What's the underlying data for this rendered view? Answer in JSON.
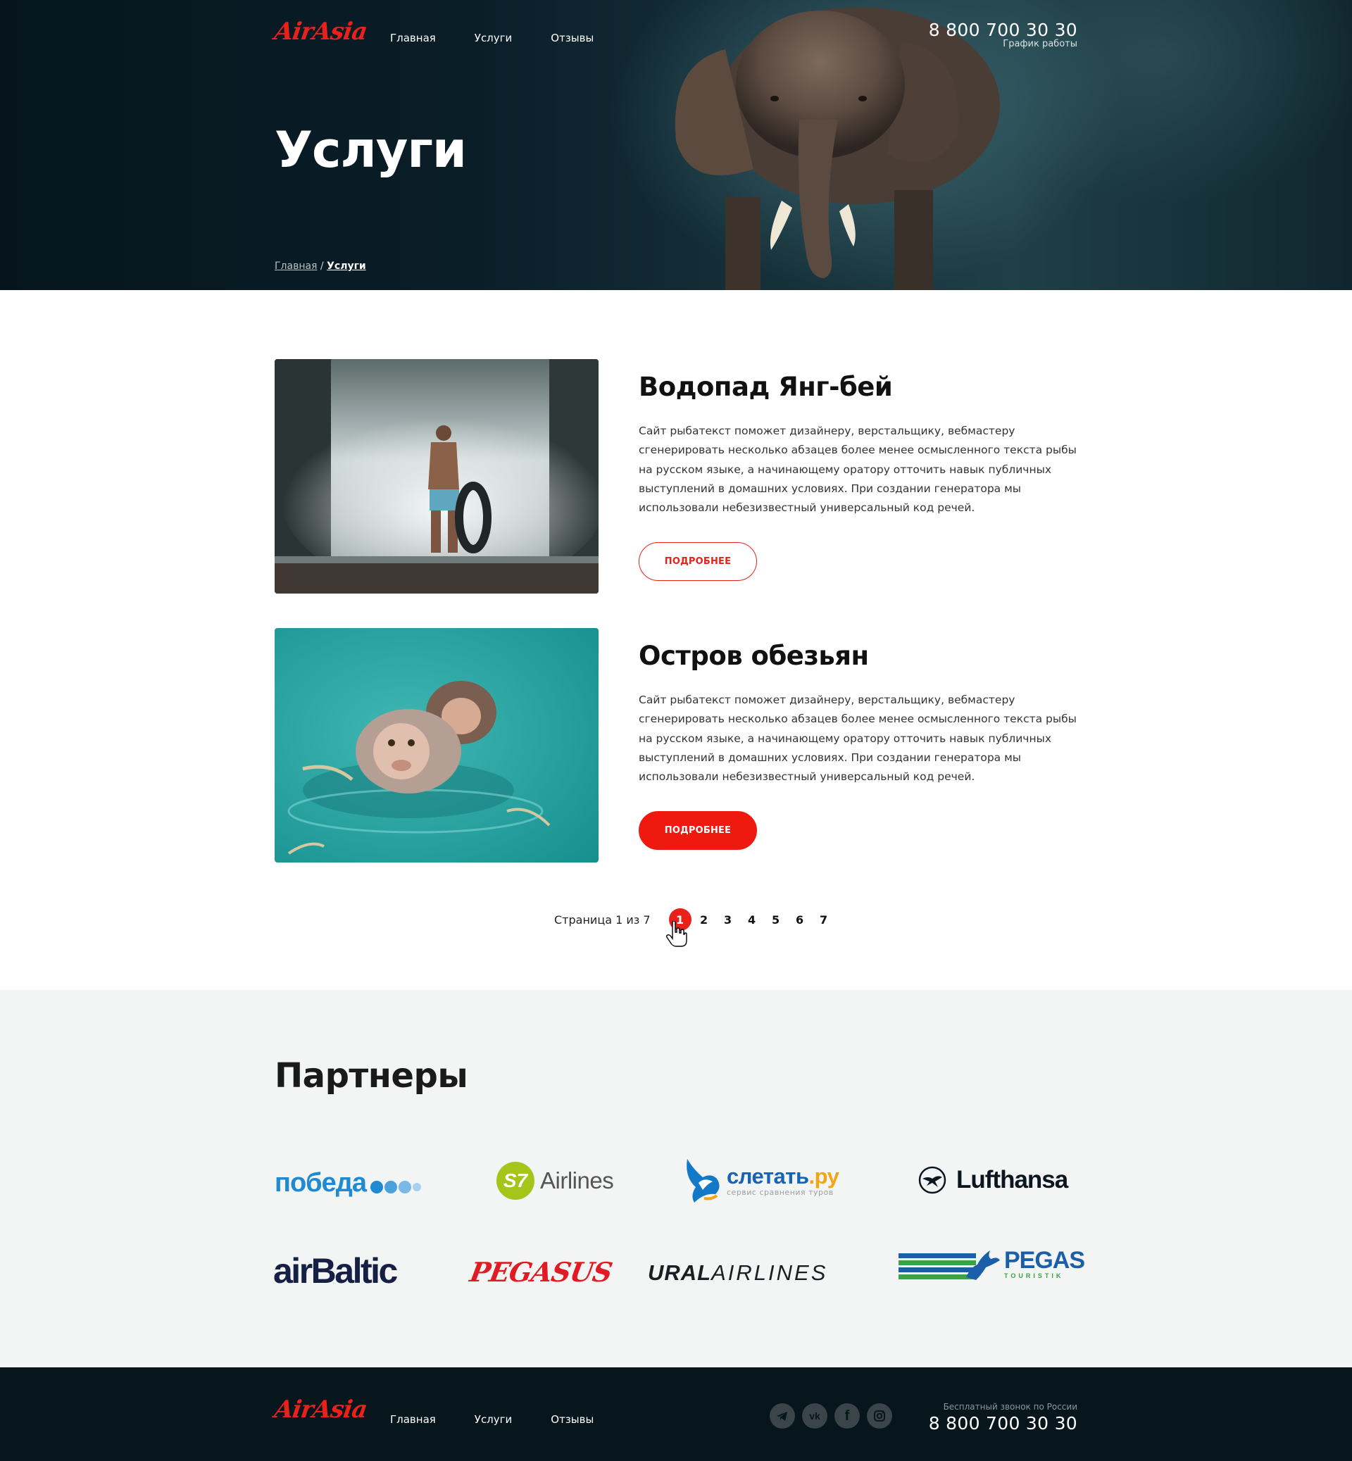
{
  "brand": {
    "logo_text": "AirAsia",
    "accent_color": "#e8221b"
  },
  "header": {
    "nav": [
      "Главная",
      "Услуги",
      "Отзывы"
    ],
    "phone": "8 800 700 30 30",
    "schedule": "График работы"
  },
  "hero": {
    "title": "Услуги",
    "breadcrumb_home": "Главная",
    "breadcrumb_sep": " / ",
    "breadcrumb_current": "Услуги"
  },
  "services": [
    {
      "title": "Водопад Янг-бей",
      "text": "Сайт рыбатекст поможет дизайнеру, верстальщику, вебмастеру сгенерировать несколько абзацев более менее осмысленного текста рыбы на русском языке, а начинающему оратору отточить навык публичных выступлений в домашних условиях. При создании генератора мы использовали небезизвестный универсальный код речей.",
      "button": "ПОДРОБНЕЕ"
    },
    {
      "title": "Остров обезьян",
      "text": "Сайт рыбатекст поможет дизайнеру, верстальщику, вебмастеру сгенерировать несколько абзацев более менее осмысленного текста рыбы на русском языке, а начинающему оратору отточить навык публичных выступлений в домашних условиях. При создании генератора мы использовали небезизвестный универсальный код речей.",
      "button": "ПОДРОБНЕЕ"
    }
  ],
  "pagination": {
    "info": "Страница 1 из 7",
    "pages": [
      "1",
      "2",
      "3",
      "4",
      "5",
      "6",
      "7"
    ],
    "current": "1"
  },
  "partners": {
    "title": "Партнеры",
    "pobeda": "победа",
    "s7_mark": "S7",
    "s7_word": "Airlines",
    "sletat_name": "слетать",
    "sletat_tld": ".ру",
    "sletat_tagline": "сервис сравнения туров",
    "lufthansa": "Lufthansa",
    "airbaltic": "airBaltic",
    "pegasus": "PEGASUS",
    "ural_bold": "URAL",
    "ural_light": "AIRLINES",
    "pegas": "PEGAS",
    "pegas_sub": "TOURISTIK"
  },
  "footer": {
    "nav": [
      "Главная",
      "Услуги",
      "Отзывы"
    ],
    "social": [
      "telegram-icon",
      "vk-icon",
      "facebook-icon",
      "instagram-icon"
    ],
    "social_vk_text": "vk",
    "social_fb_text": "f",
    "call_label": "Бесплатный звонок по России",
    "phone": "8 800 700 30 30"
  }
}
